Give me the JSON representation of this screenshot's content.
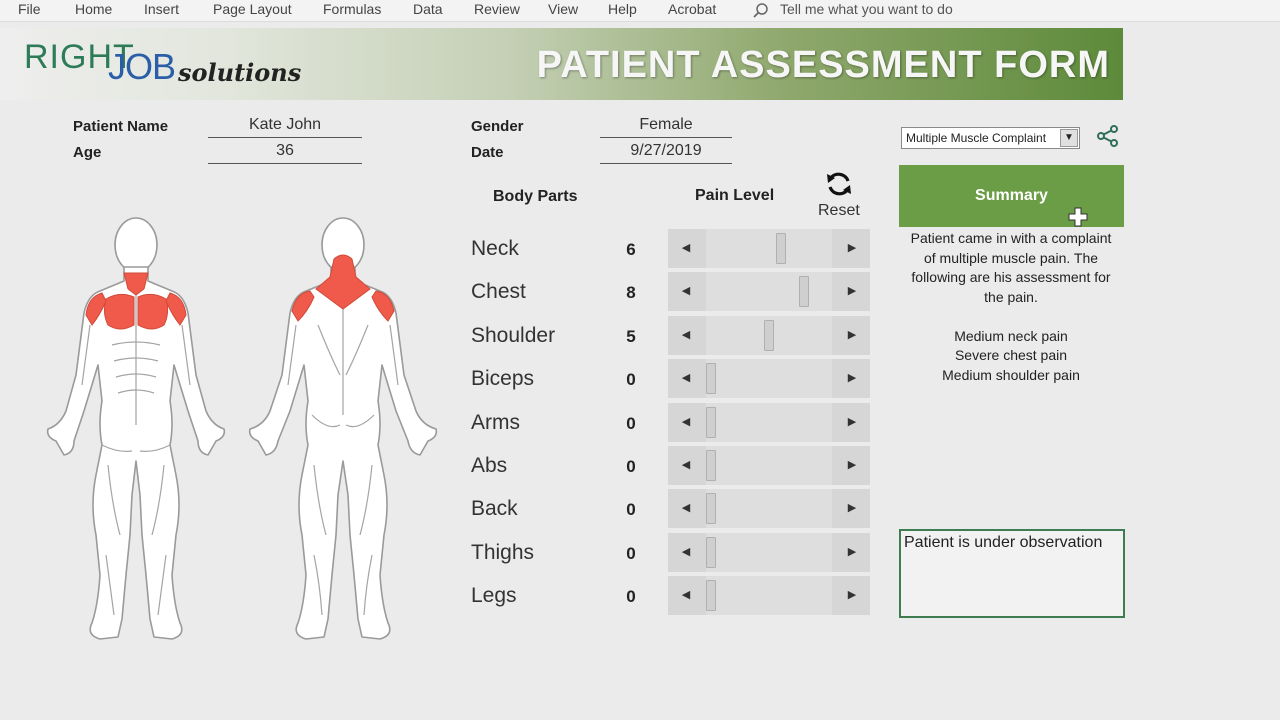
{
  "ribbon": {
    "tabs": [
      "File",
      "Home",
      "Insert",
      "Page Layout",
      "Formulas",
      "Data",
      "Review",
      "View",
      "Help",
      "Acrobat"
    ],
    "tell_me": "Tell me what you want to do"
  },
  "header": {
    "logo_right": "RIGHT",
    "logo_job": "JOB",
    "logo_solutions": "solutions",
    "title": "PATIENT ASSESSMENT FORM"
  },
  "patient": {
    "name_label": "Patient Name",
    "name": "Kate John",
    "age_label": "Age",
    "age": "36",
    "gender_label": "Gender",
    "gender": "Female",
    "date_label": "Date",
    "date": "9/27/2019"
  },
  "complaint_dropdown": {
    "selected": "Multiple Muscle Complaint"
  },
  "table": {
    "body_parts_header": "Body Parts",
    "pain_level_header": "Pain Level",
    "reset_label": "Reset",
    "rows": [
      {
        "part": "Neck",
        "level": "6",
        "value": 6
      },
      {
        "part": "Chest",
        "level": "8",
        "value": 8
      },
      {
        "part": "Shoulder",
        "level": "5",
        "value": 5
      },
      {
        "part": "Biceps",
        "level": "0",
        "value": 0
      },
      {
        "part": "Arms",
        "level": "0",
        "value": 0
      },
      {
        "part": "Abs",
        "level": "0",
        "value": 0
      },
      {
        "part": "Back",
        "level": "0",
        "value": 0
      },
      {
        "part": "Thighs",
        "level": "0",
        "value": 0
      },
      {
        "part": "Legs",
        "level": "0",
        "value": 0
      }
    ],
    "slider_max": 10
  },
  "summary": {
    "button_label": "Summary",
    "intro": [
      "Patient came in with a complaint",
      "of multiple muscle pain. The",
      "following are his assessment for",
      "the pain."
    ],
    "findings": [
      "Medium neck pain",
      "Severe chest pain",
      "Medium shoulder pain"
    ],
    "observation": "Patient is under observation"
  },
  "colors": {
    "accent_green": "#6a9d45",
    "highlight_red": "#f05a4a",
    "logo_green": "#2e7b58",
    "logo_blue": "#2a5ea8"
  }
}
